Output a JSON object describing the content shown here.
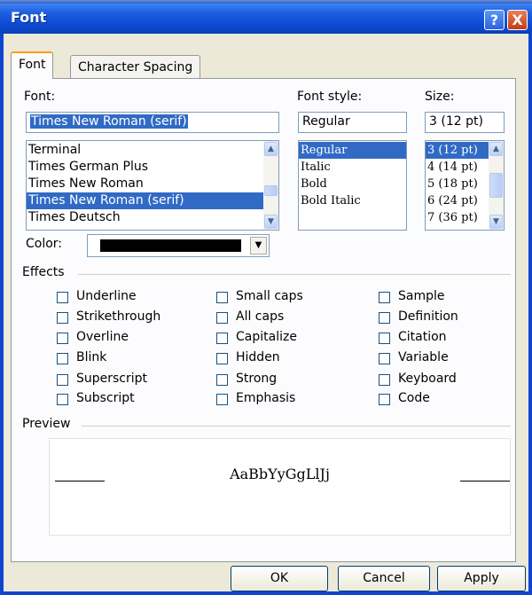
{
  "window": {
    "title": "Font",
    "help_glyph": "?",
    "close_glyph": "X"
  },
  "tabs": [
    {
      "label": "Font",
      "active": true
    },
    {
      "label": "Character Spacing",
      "active": false
    }
  ],
  "font": {
    "label": "Font:",
    "value": "Times New Roman (serif)",
    "items": [
      {
        "label": "Terminal",
        "selected": false
      },
      {
        "label": "Times German Plus",
        "selected": false
      },
      {
        "label": "Times New Roman",
        "selected": false
      },
      {
        "label": "Times New Roman (serif)",
        "selected": true
      },
      {
        "label": "Times  Deutsch",
        "selected": false
      }
    ]
  },
  "font_style": {
    "label": "Font style:",
    "value": "Regular",
    "items": [
      {
        "label": "Regular",
        "selected": true
      },
      {
        "label": "Italic",
        "selected": false
      },
      {
        "label": "Bold",
        "selected": false
      },
      {
        "label": "Bold Italic",
        "selected": false
      }
    ]
  },
  "size": {
    "label": "Size:",
    "value": "3  (12 pt)",
    "items": [
      {
        "label": "3  (12 pt)",
        "selected": true
      },
      {
        "label": "4  (14 pt)",
        "selected": false
      },
      {
        "label": "5  (18 pt)",
        "selected": false
      },
      {
        "label": "6  (24 pt)",
        "selected": false
      },
      {
        "label": "7  (36 pt)",
        "selected": false
      }
    ]
  },
  "color": {
    "label": "Color:",
    "value": "#000000"
  },
  "effects": {
    "label": "Effects",
    "col1": [
      "Underline",
      "Strikethrough",
      "Overline",
      "Blink",
      "Superscript",
      "Subscript"
    ],
    "col2": [
      "Small caps",
      "All caps",
      "Capitalize",
      "Hidden",
      "Strong",
      "Emphasis"
    ],
    "col3": [
      "Sample",
      "Definition",
      "Citation",
      "Variable",
      "Keyboard",
      "Code"
    ]
  },
  "preview": {
    "label": "Preview",
    "sample": "AaBbYyGgLlJj"
  },
  "buttons": {
    "ok": "OK",
    "cancel": "Cancel",
    "apply": "Apply"
  },
  "colors": {
    "titlebar": "#0a3fb8",
    "selection": "#316ac5",
    "dialog_bg": "#ece9d8"
  },
  "icons": {
    "help": "help-icon",
    "close": "close-icon",
    "scroll_up": "chevron-up-icon",
    "scroll_down": "chevron-down-icon",
    "dropdown": "triangle-down-icon"
  }
}
